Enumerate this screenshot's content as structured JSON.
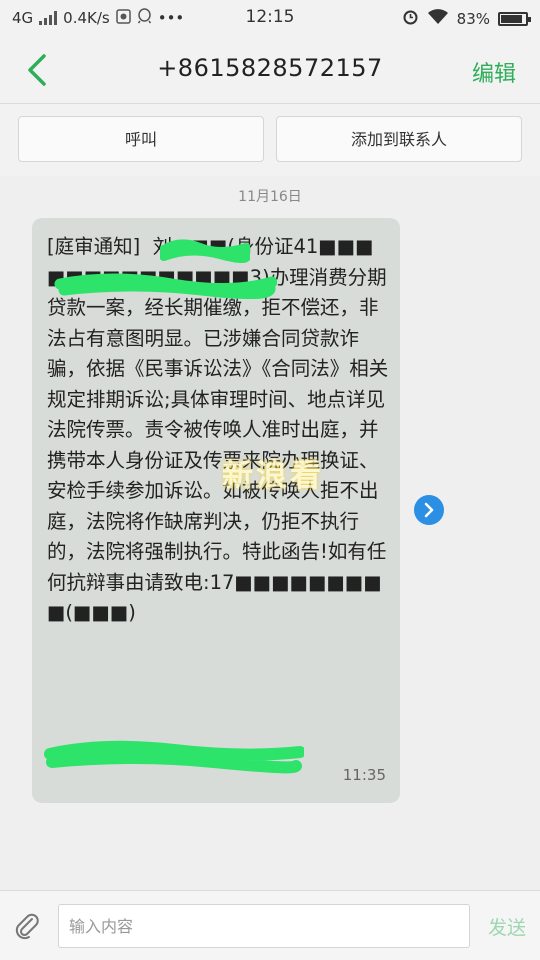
{
  "status_bar": {
    "network": "4G",
    "speed": "0.4K/s",
    "time": "12:15",
    "battery": "83%"
  },
  "header": {
    "title": "+8615828572157",
    "edit_label": "编辑"
  },
  "actions": {
    "call_label": "呼叫",
    "add_contact_label": "添加到联系人"
  },
  "conversation": {
    "date": "11月16日",
    "message": {
      "text": "[庭审通知]  刘■■■(身份证41■■■■■■■■■■■■■■3)办理消费分期贷款一案，经长期催缴，拒不偿还，非法占有意图明显。已涉嫌合同贷款诈骗，依据《民事诉讼法》《合同法》相关规定排期诉讼;具体审理时间、地点详见法院传票。责令被传唤人准时出庭，并携带本人身份证及传票来院办理换证、安检手续参加诉讼。如被传唤人拒不出庭，法院将作缺席判决，仍拒不执行的，法院将强制执行。特此函告!如有任何抗辩事由请致电:17■■■■■■■■■(■■■)",
      "time": "11:35"
    }
  },
  "watermark": "新浪看",
  "input": {
    "placeholder": "输入内容",
    "send_label": "发送"
  },
  "colors": {
    "accent": "#2fae5a",
    "bubble": "#d8dcd8",
    "forward": "#2b8fe3",
    "scribble": "#2ee36a"
  },
  "icons": [
    "back-arrow-icon",
    "attachment-icon",
    "forward-icon",
    "wifi-icon",
    "alarm-icon",
    "battery-icon"
  ]
}
